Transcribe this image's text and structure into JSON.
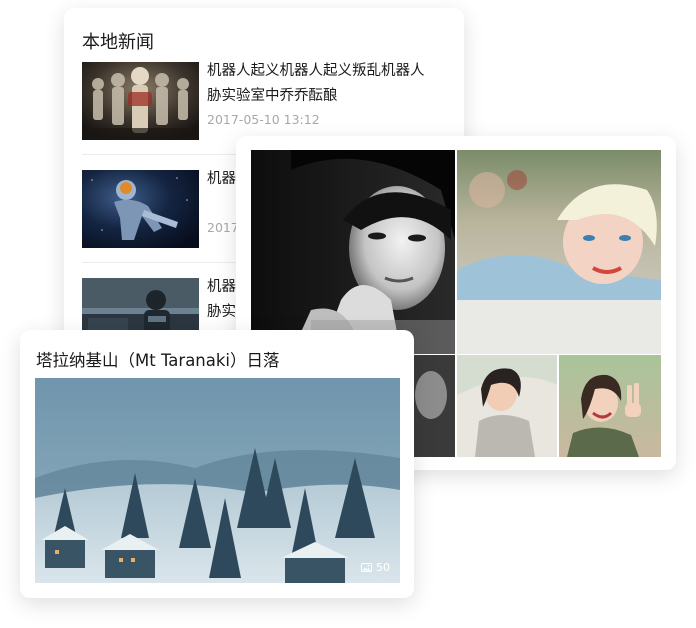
{
  "news_card": {
    "title": "本地新闻",
    "items": [
      {
        "headline_line1": "机器人起义机器人起义叛乱机器人",
        "headline_line2": "胁实验室中乔乔酝酿",
        "date": "2017-05-10 13:12",
        "thumb": "robot-skeletons-image"
      },
      {
        "headline_line1": "机器",
        "headline_line2": "",
        "date": "2017",
        "thumb": "astronaut-robot-image"
      },
      {
        "headline_line1": "机器",
        "headline_line2": "胁实",
        "date": "",
        "thumb": "mech-robot-image"
      }
    ]
  },
  "photo_grid": {
    "photos": [
      {
        "name": "portrait-bw-woman-image"
      },
      {
        "name": "portrait-blonde-woman-image"
      },
      {
        "name": "portrait-bw-partial-image"
      },
      {
        "name": "portrait-short-hair-woman-image"
      },
      {
        "name": "portrait-peace-sign-woman-image"
      }
    ]
  },
  "landscape_card": {
    "title": "塔拉纳基山（Mt Taranaki）日落",
    "photo": "snowy-village-image",
    "photo_count": "50",
    "count_icon": "image-icon"
  }
}
